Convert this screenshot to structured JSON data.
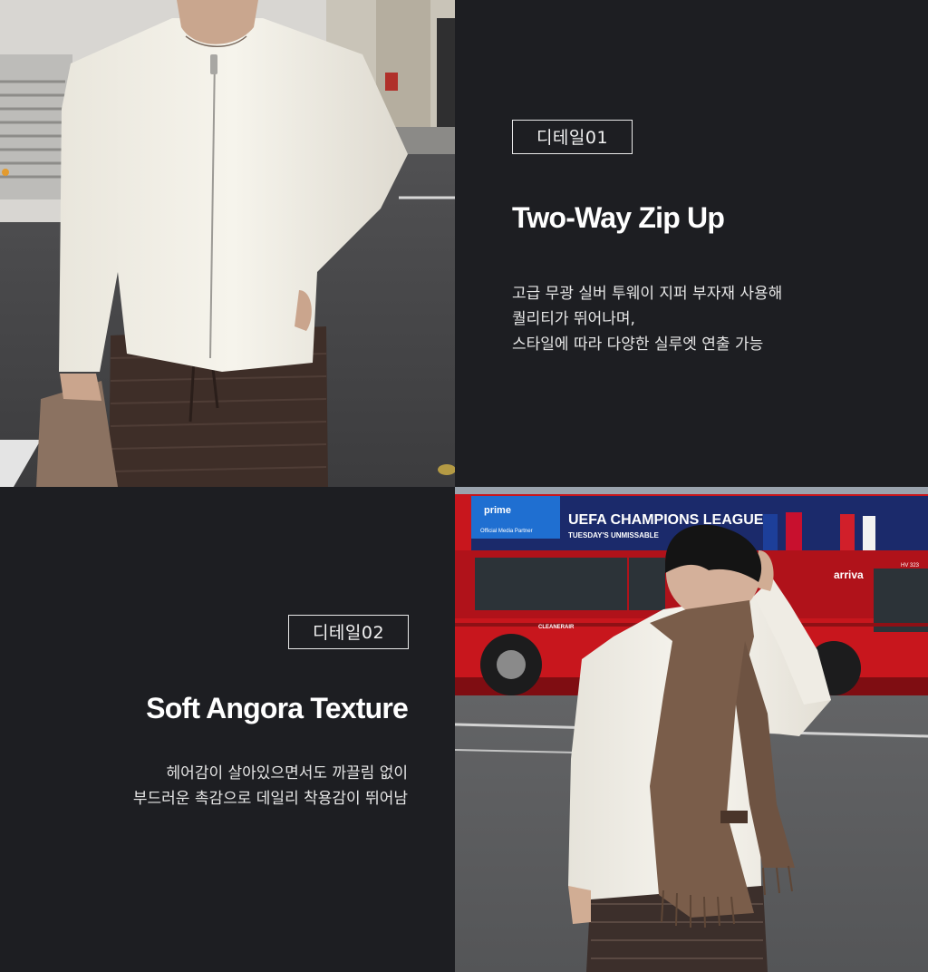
{
  "detail1": {
    "tag": "디테일01",
    "title": "Two-Way Zip Up",
    "lines": [
      "고급 무광 실버 투웨이 지퍼 부자재 사용해",
      "퀄리티가 뛰어나며,",
      "스타일에 따라 다양한 실루엣 연출 가능"
    ]
  },
  "detail2": {
    "tag": "디테일02",
    "title": "Soft Angora Texture",
    "lines": [
      "헤어감이 살아있으면서도 까끌림 없이",
      "부드러운 촉감으로 데일리 착용감이 뛰어남"
    ]
  },
  "bus_ad": {
    "brand": "prime",
    "sub": "Official Media Partner",
    "headline": "UEFA CHAMPIONS LEAGUE",
    "tagline": "TUESDAY'S UNMISSABLE",
    "operator": "arriva",
    "route": "HV 323",
    "side_text": "CLEANERAIR"
  },
  "colors": {
    "panel": "#1d1e22",
    "bus_red": "#c8161d",
    "sweater": "#efece2",
    "scarf": "#7a5d4a"
  }
}
